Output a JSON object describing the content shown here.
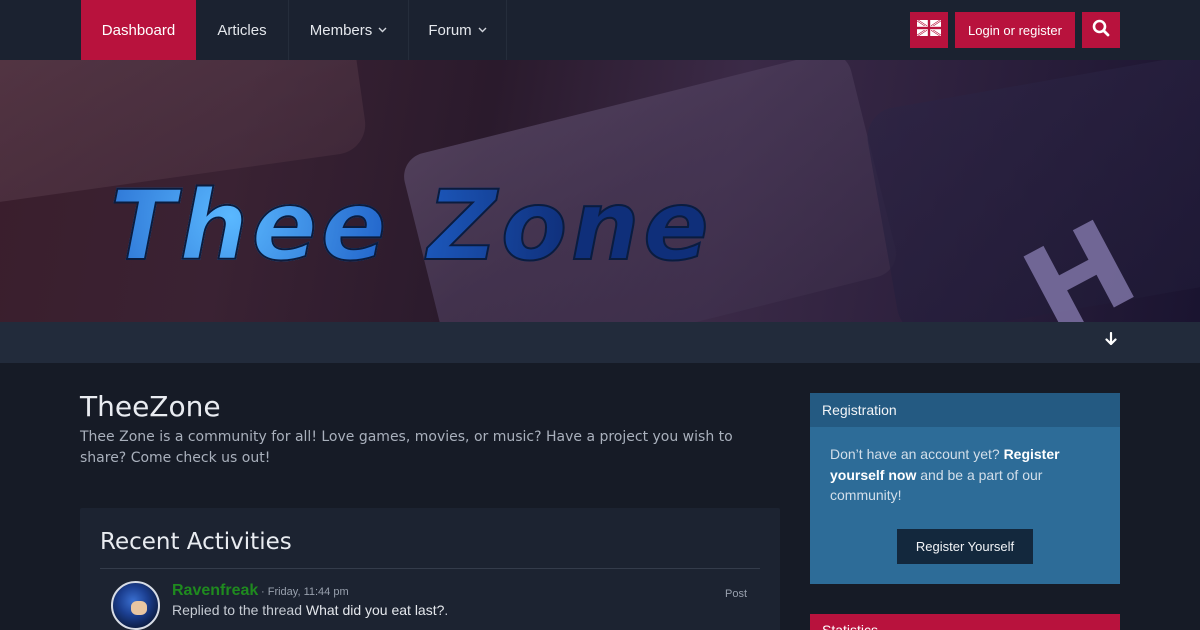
{
  "nav": {
    "items": [
      {
        "label": "Dashboard",
        "has_dropdown": false,
        "active": true
      },
      {
        "label": "Articles",
        "has_dropdown": false,
        "active": false
      },
      {
        "label": "Members",
        "has_dropdown": true,
        "active": false
      },
      {
        "label": "Forum",
        "has_dropdown": true,
        "active": false
      }
    ],
    "login_label": "Login or register",
    "flag_icon": "uk-flag-icon",
    "search_icon": "search-icon",
    "accent_color": "#b8123d"
  },
  "banner": {
    "logo_text": "Thee Zone"
  },
  "page": {
    "title": "TheeZone",
    "description": "Thee Zone is a community for all! Love games, movies, or music? Have a project you wish to share? Come check us out!"
  },
  "activities": {
    "title": "Recent Activities",
    "items": [
      {
        "user": "Ravenfreak",
        "time": "· Friday, 11:44 pm",
        "type": "Post",
        "action": "Replied to the thread ",
        "thread": "What did you eat last?",
        "suffix": "."
      }
    ]
  },
  "registration": {
    "title": "Registration",
    "text_prefix": "Don’t have an account yet? ",
    "text_bold": "Register yourself now",
    "text_suffix": " and be a part of our community!",
    "button_label": "Register Yourself"
  },
  "statistics": {
    "title": "Statistics"
  }
}
